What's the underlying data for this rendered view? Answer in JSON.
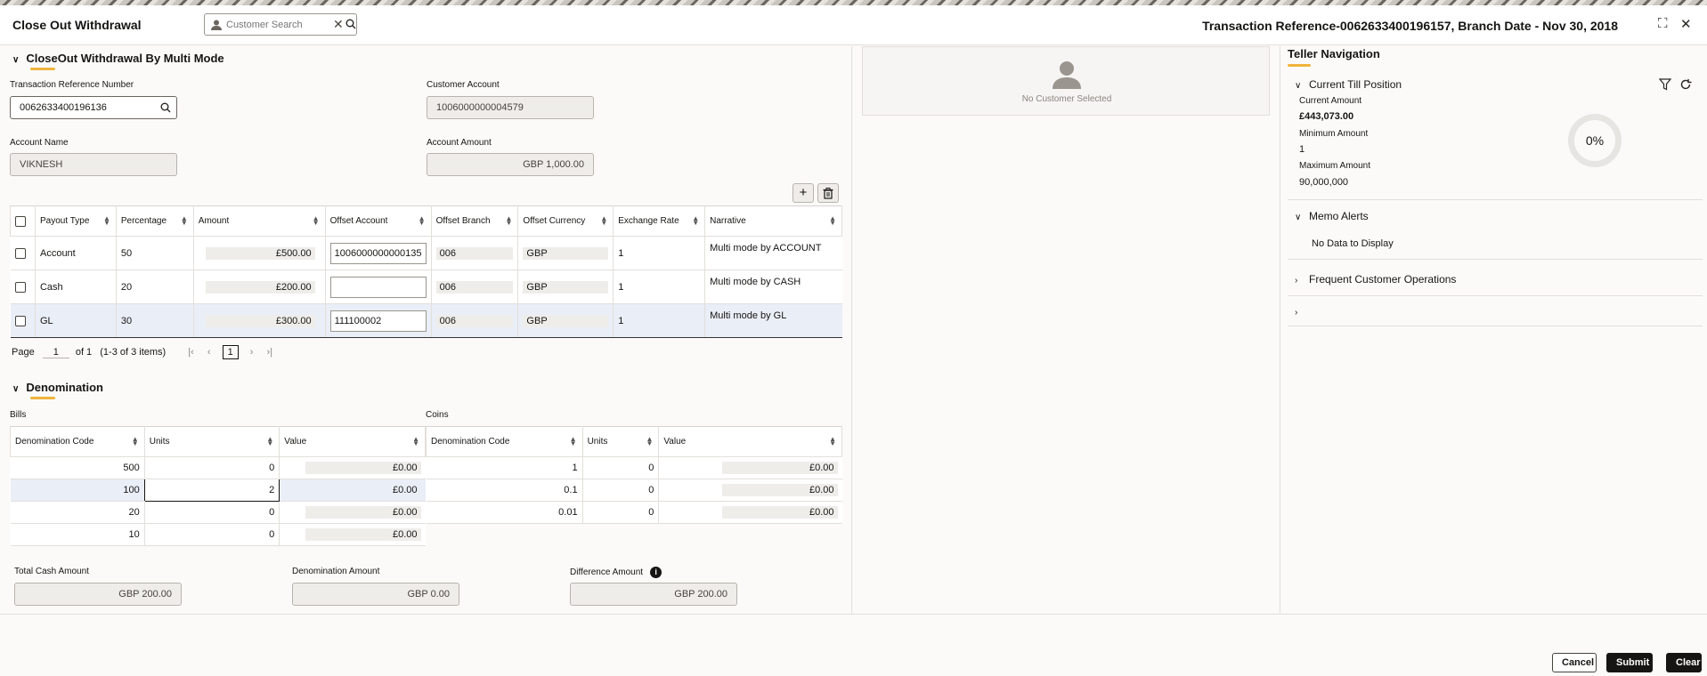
{
  "header": {
    "title": "Close Out Withdrawal",
    "customer_search_placeholder": "Customer Search",
    "transaction_reference": "Transaction Reference-0062633400196157, Branch Date - Nov 30, 2018"
  },
  "closeout": {
    "section_title": "CloseOut Withdrawal By Multi Mode",
    "txn_ref_label": "Transaction Reference Number",
    "txn_ref_value": "0062633400196136",
    "customer_account_label": "Customer Account",
    "customer_account_value": "1006000000004579",
    "account_name_label": "Account Name",
    "account_name_value": "VIKNESH",
    "account_amount_label": "Account Amount",
    "account_amount_value": "GBP 1,000.00"
  },
  "payout_table": {
    "headers": [
      "Payout Type",
      "Percentage",
      "Amount",
      "Offset Account",
      "Offset Branch",
      "Offset Currency",
      "Exchange Rate",
      "Narrative"
    ],
    "rows": [
      {
        "type": "Account",
        "percentage": "50",
        "amount": "£500.00",
        "offset_account": "1006000000000135",
        "offset_branch": "006",
        "offset_currency": "GBP",
        "exchange_rate": "1",
        "narrative": "Multi mode by ACCOUNT"
      },
      {
        "type": "Cash",
        "percentage": "20",
        "amount": "£200.00",
        "offset_account": "",
        "offset_branch": "006",
        "offset_currency": "GBP",
        "exchange_rate": "1",
        "narrative": "Multi mode by CASH"
      },
      {
        "type": "GL",
        "percentage": "30",
        "amount": "£300.00",
        "offset_account": "111100002",
        "offset_branch": "006",
        "offset_currency": "GBP",
        "exchange_rate": "1",
        "narrative": "Multi mode by GL"
      }
    ],
    "pager": {
      "page_label": "Page",
      "page": "1",
      "of": "of 1",
      "items": "(1-3 of 3 items)",
      "current": "1"
    }
  },
  "denomination": {
    "section_title": "Denomination",
    "bills_label": "Bills",
    "coins_label": "Coins",
    "headers": [
      "Denomination Code",
      "Units",
      "Value"
    ],
    "bills": [
      {
        "code": "500",
        "units": "0",
        "value": "£0.00"
      },
      {
        "code": "100",
        "units": "2",
        "value": "£0.00"
      },
      {
        "code": "20",
        "units": "0",
        "value": "£0.00"
      },
      {
        "code": "10",
        "units": "0",
        "value": "£0.00"
      }
    ],
    "coins": [
      {
        "code": "1",
        "units": "0",
        "value": "£0.00"
      },
      {
        "code": "0.1",
        "units": "0",
        "value": "£0.00"
      },
      {
        "code": "0.01",
        "units": "0",
        "value": "£0.00"
      }
    ]
  },
  "totals": {
    "total_cash_label": "Total Cash Amount",
    "total_cash_value": "GBP 200.00",
    "denomination_amount_label": "Denomination Amount",
    "denomination_amount_value": "GBP 0.00",
    "difference_amount_label": "Difference Amount",
    "difference_amount_value": "GBP 200.00"
  },
  "customer_panel": {
    "no_customer": "No Customer Selected"
  },
  "teller": {
    "title": "Teller Navigation",
    "till_title": "Current Till Position",
    "current_amount_label": "Current Amount",
    "current_amount_value": "£443,073.00",
    "minimum_amount_label": "Minimum Amount",
    "minimum_amount_value": "1",
    "maximum_amount_label": "Maximum Amount",
    "maximum_amount_value": "90,000,000",
    "till_percent": "0%",
    "memo_title": "Memo Alerts",
    "memo_empty": "No Data to Display",
    "frequent_title": "Frequent Customer Operations"
  },
  "footer": {
    "cancel": "Cancel",
    "submit": "Submit",
    "clear": "Clear"
  },
  "icons": {
    "filter": "filter-icon",
    "refresh": "refresh-icon",
    "add": "plus-icon",
    "delete": "trash-icon",
    "search": "search-icon"
  }
}
